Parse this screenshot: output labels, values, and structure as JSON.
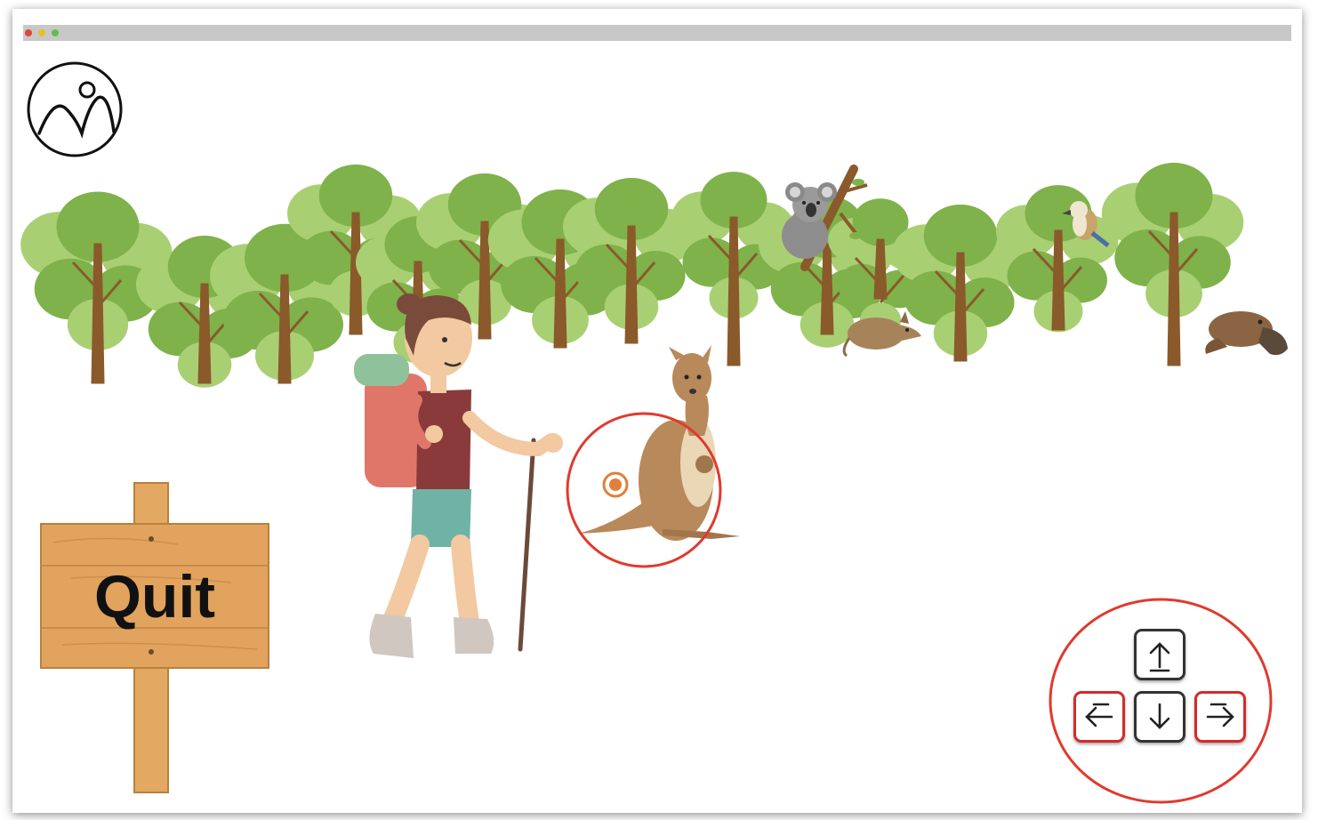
{
  "window": {
    "dots": [
      "#e0443a",
      "#e6c02c",
      "#5ec04a"
    ]
  },
  "quit_sign": {
    "label": "Quit"
  },
  "controls": {
    "up_key_icon": "arrow-up-icon",
    "down_key_icon": "arrow-down-icon",
    "left_key_icon": "arrow-left-icon",
    "right_key_icon": "arrow-right-icon",
    "highlighted_keys": [
      "left",
      "right"
    ],
    "highlight_color": "#d42a2a"
  },
  "colors": {
    "tree_dark": "#7fb24a",
    "tree_light": "#a9cf73",
    "trunk": "#8a5a2a",
    "kangaroo": "#b8895a",
    "sign_wood": "#e0a560",
    "annotation": "#e03a2e"
  }
}
